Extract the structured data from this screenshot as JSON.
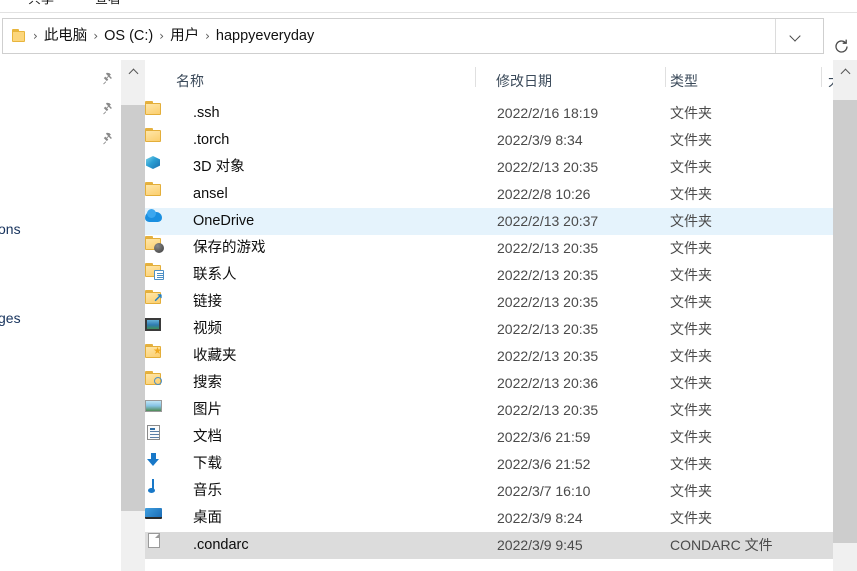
{
  "window": {
    "ribbon_tabs": [
      "共享",
      "查看"
    ]
  },
  "address": {
    "folder_icon": "folder-icon",
    "separator": "›",
    "crumbs": [
      "此电脑",
      "OS (C:)",
      "用户",
      "happyeveryday"
    ],
    "dropdown_icon": "chevron-down-icon",
    "refresh_icon": "refresh-icon",
    "refresh_glyph": "↻"
  },
  "navpane": {
    "clipped_labels": [
      "ons",
      "ges"
    ],
    "pin_icon": "pin-icon",
    "pins": 3,
    "scroll_up_icon": "caret-up-icon"
  },
  "filelist": {
    "sort_indicator_icon": "sort-ascending-icon",
    "columns": [
      {
        "key": "name",
        "label": "名称"
      },
      {
        "key": "date",
        "label": "修改日期"
      },
      {
        "key": "type",
        "label": "类型"
      },
      {
        "key": "size",
        "label": "大"
      }
    ],
    "rows": [
      {
        "name": "",
        "date": "",
        "type": "",
        "icon": "folder-icon",
        "state": "clipped"
      },
      {
        "name": ".ssh",
        "date": "2022/2/16 18:19",
        "type": "文件夹",
        "icon": "folder-icon",
        "state": "normal"
      },
      {
        "name": ".torch",
        "date": "2022/3/9 8:34",
        "type": "文件夹",
        "icon": "folder-icon",
        "state": "normal"
      },
      {
        "name": "3D 对象",
        "date": "2022/2/13 20:35",
        "type": "文件夹",
        "icon": "3d-objects-icon",
        "state": "normal"
      },
      {
        "name": "ansel",
        "date": "2022/2/8 10:26",
        "type": "文件夹",
        "icon": "folder-icon",
        "state": "normal"
      },
      {
        "name": "OneDrive",
        "date": "2022/2/13 20:37",
        "type": "文件夹",
        "icon": "onedrive-icon",
        "state": "selected"
      },
      {
        "name": "保存的游戏",
        "date": "2022/2/13 20:35",
        "type": "文件夹",
        "icon": "saved-games-folder-icon",
        "state": "normal"
      },
      {
        "name": "联系人",
        "date": "2022/2/13 20:35",
        "type": "文件夹",
        "icon": "contacts-folder-icon",
        "state": "normal"
      },
      {
        "name": "链接",
        "date": "2022/2/13 20:35",
        "type": "文件夹",
        "icon": "links-folder-icon",
        "state": "normal"
      },
      {
        "name": "视频",
        "date": "2022/2/13 20:35",
        "type": "文件夹",
        "icon": "videos-icon",
        "state": "normal"
      },
      {
        "name": "收藏夹",
        "date": "2022/2/13 20:35",
        "type": "文件夹",
        "icon": "favorites-folder-icon",
        "state": "normal"
      },
      {
        "name": "搜索",
        "date": "2022/2/13 20:36",
        "type": "文件夹",
        "icon": "searches-folder-icon",
        "state": "normal"
      },
      {
        "name": "图片",
        "date": "2022/2/13 20:35",
        "type": "文件夹",
        "icon": "pictures-icon",
        "state": "normal"
      },
      {
        "name": "文档",
        "date": "2022/3/6 21:59",
        "type": "文件夹",
        "icon": "documents-icon",
        "state": "normal"
      },
      {
        "name": "下载",
        "date": "2022/3/6 21:52",
        "type": "文件夹",
        "icon": "downloads-icon",
        "state": "normal"
      },
      {
        "name": "音乐",
        "date": "2022/3/7 16:10",
        "type": "文件夹",
        "icon": "music-icon",
        "state": "normal"
      },
      {
        "name": "桌面",
        "date": "2022/3/9 8:24",
        "type": "文件夹",
        "icon": "desktop-icon",
        "state": "normal"
      },
      {
        "name": ".condarc",
        "date": "2022/3/9 9:45",
        "type": "CONDARC 文件",
        "icon": "generic-file-icon",
        "state": "hovered"
      }
    ]
  },
  "scrollbar": {
    "up_icon": "caret-up-icon"
  },
  "colors": {
    "selection": "#e5f3fc",
    "hover": "#dcdcdc",
    "folder": "#fcd77f",
    "accent_blue": "#1878c8",
    "header_text": "#3b4a5a",
    "nav_text": "#16325c"
  }
}
